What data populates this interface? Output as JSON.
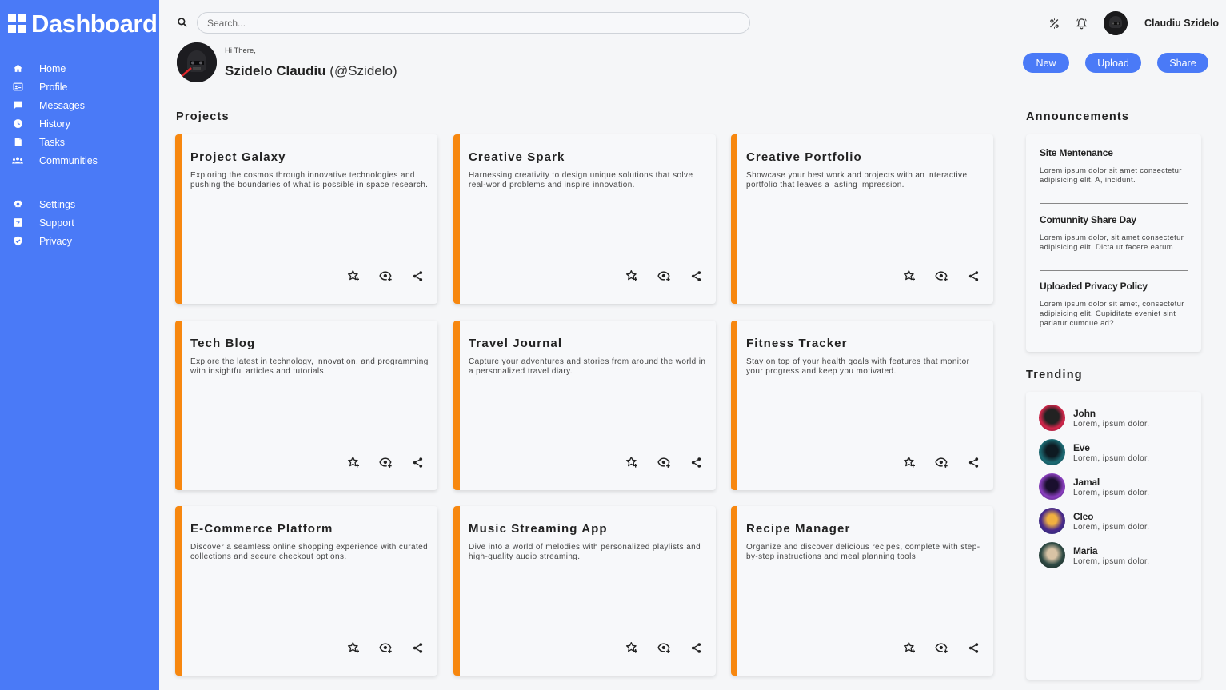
{
  "app": {
    "title": "Dashboard"
  },
  "colors": {
    "accent": "#4a7af7",
    "card_border": "#f7870f",
    "background": "#f5f6f8"
  },
  "sidebar": {
    "main_items": [
      {
        "label": "Home",
        "icon": "home-icon"
      },
      {
        "label": "Profile",
        "icon": "profile-card-icon"
      },
      {
        "label": "Messages",
        "icon": "message-icon"
      },
      {
        "label": "History",
        "icon": "clock-icon"
      },
      {
        "label": "Tasks",
        "icon": "document-icon"
      },
      {
        "label": "Communities",
        "icon": "people-icon"
      }
    ],
    "secondary_items": [
      {
        "label": "Settings",
        "icon": "gear-icon"
      },
      {
        "label": "Support",
        "icon": "help-icon"
      },
      {
        "label": "Privacy",
        "icon": "shield-icon"
      }
    ]
  },
  "header": {
    "search_placeholder": "Search...",
    "username": "Claudiu Szidelo",
    "greeting": "Hi There,",
    "profile_name": "Szidelo Claudiu",
    "profile_handle": "(@Szidelo)",
    "buttons": {
      "new": "New",
      "upload": "Upload",
      "share": "Share"
    }
  },
  "projects": {
    "title": "Projects",
    "items": [
      {
        "title": "Project Galaxy",
        "description": "Exploring the cosmos through innovative technologies and pushing the boundaries of what is possible in space research."
      },
      {
        "title": "Creative Spark",
        "description": "Harnessing creativity to design unique solutions that solve real-world problems and inspire innovation."
      },
      {
        "title": "Creative Portfolio",
        "description": "Showcase your best work and projects with an interactive portfolio that leaves a lasting impression."
      },
      {
        "title": "Tech Blog",
        "description": "Explore the latest in technology, innovation, and programming with insightful articles and tutorials."
      },
      {
        "title": "Travel Journal",
        "description": "Capture your adventures and stories from around the world in a personalized travel diary."
      },
      {
        "title": "Fitness Tracker",
        "description": "Stay on top of your health goals with features that monitor your progress and keep you motivated."
      },
      {
        "title": "E-Commerce Platform",
        "description": "Discover a seamless online shopping experience with curated collections and secure checkout options."
      },
      {
        "title": "Music Streaming App",
        "description": "Dive into a world of melodies with personalized playlists and high-quality audio streaming."
      },
      {
        "title": "Recipe Manager",
        "description": "Organize and discover delicious recipes, complete with step-by-step instructions and meal planning tools."
      }
    ]
  },
  "announcements": {
    "title": "Announcements",
    "items": [
      {
        "title": "Site Mentenance",
        "text": "Lorem ipsum dolor sit amet consectetur adipisicing elit. A, incidunt."
      },
      {
        "title": "Comunnity Share Day",
        "text": "Lorem ipsum dolor, sit amet consectetur adipisicing elit. Dicta ut facere earum."
      },
      {
        "title": "Uploaded Privacy Policy",
        "text": "Lorem ipsum dolor sit amet, consectetur adipisicing elit. Cupiditate eveniet sint pariatur cumque ad?"
      }
    ]
  },
  "trending": {
    "title": "Trending",
    "items": [
      {
        "name": "John",
        "text": "Lorem, ipsum dolor."
      },
      {
        "name": "Eve",
        "text": "Lorem, ipsum dolor."
      },
      {
        "name": "Jamal",
        "text": "Lorem, ipsum dolor."
      },
      {
        "name": "Cleo",
        "text": "Lorem, ipsum dolor."
      },
      {
        "name": "Maria",
        "text": "Lorem, ipsum dolor."
      }
    ]
  }
}
